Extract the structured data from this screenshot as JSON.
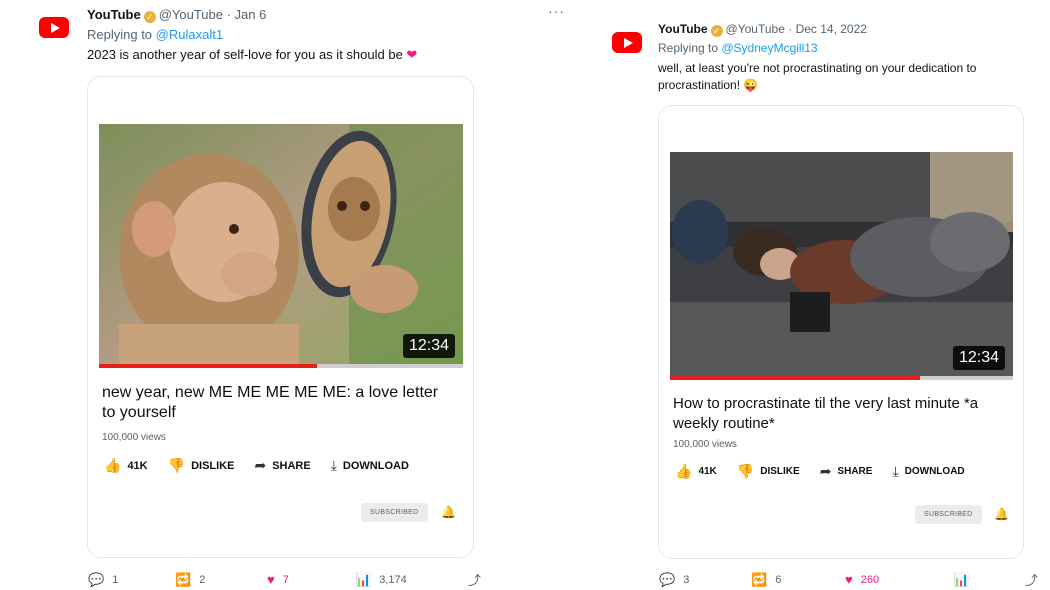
{
  "tweets": [
    {
      "author": "YouTube",
      "handle": "@YouTube",
      "date": "· Jan 6",
      "replying_prefix": "Replying to ",
      "replying_to": "@Rulaxalt1",
      "text": "2023 is another year of self-love for you as it should be",
      "emoji": "❤",
      "video": {
        "duration": "12:34",
        "progress": 0.6,
        "title": "new year, new ME ME ME ME ME: a love letter to yourself",
        "views": "100,000 views",
        "like_count": "41K",
        "dislike_label": "DISLIKE",
        "share_label": "SHARE",
        "download_label": "DOWNLOAD",
        "subscribed_label": "SUBSCRIBED"
      },
      "stats": {
        "replies": "1",
        "retweets": "2",
        "likes": "7",
        "views": "3,174"
      }
    },
    {
      "author": "YouTube",
      "handle": "@YouTube",
      "date": "· Dec 14, 2022",
      "replying_prefix": "Replying to ",
      "replying_to": "@SydneyMcgill13",
      "text": "well, at least you're not procrastinating on your dedication to procrastination!",
      "emoji": "😜",
      "video": {
        "duration": "12:34",
        "progress": 0.73,
        "title": "How to procrastinate til the very last minute *a weekly routine*",
        "views": "100,000 views",
        "like_count": "41K",
        "dislike_label": "DISLIKE",
        "share_label": "SHARE",
        "download_label": "DOWNLOAD",
        "subscribed_label": "SUBSCRIBED"
      },
      "stats": {
        "replies": "3",
        "retweets": "6",
        "likes": "260",
        "views": ""
      }
    }
  ],
  "colors": {
    "youtube_red": "#ff0000",
    "link_blue": "#1d9bf0",
    "like_pink": "#f91880",
    "progress_red": "#e62117"
  },
  "icons": [
    "youtube-logo-icon",
    "verified-badge-icon",
    "more-icon",
    "thumbs-up-icon",
    "thumbs-down-icon",
    "share-icon",
    "download-icon",
    "bell-icon",
    "reply-icon",
    "retweet-icon",
    "heart-icon",
    "views-icon",
    "share-tweet-icon"
  ]
}
